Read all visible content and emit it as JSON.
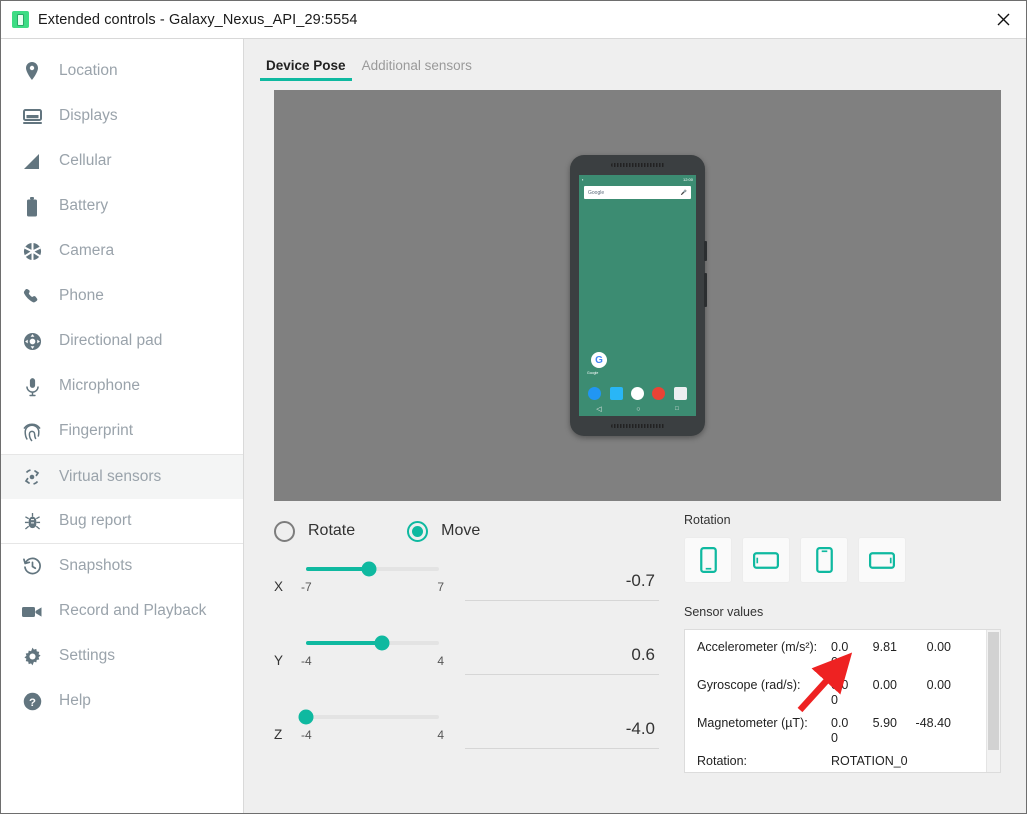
{
  "window": {
    "title": "Extended controls - Galaxy_Nexus_API_29:5554",
    "app_icon": "android-emulator-icon",
    "close_label": "×"
  },
  "sidebar": {
    "items": [
      {
        "label": "Location",
        "icon": "location-pin-icon",
        "active": false
      },
      {
        "label": "Displays",
        "icon": "monitor-icon",
        "active": false
      },
      {
        "label": "Cellular",
        "icon": "signal-bars-icon",
        "active": false
      },
      {
        "label": "Battery",
        "icon": "battery-icon",
        "active": false
      },
      {
        "label": "Camera",
        "icon": "camera-aperture-icon",
        "active": false
      },
      {
        "label": "Phone",
        "icon": "phone-handset-icon",
        "active": false
      },
      {
        "label": "Directional pad",
        "icon": "dpad-icon",
        "active": false
      },
      {
        "label": "Microphone",
        "icon": "microphone-icon",
        "active": false
      },
      {
        "label": "Fingerprint",
        "icon": "fingerprint-icon",
        "active": false
      },
      {
        "label": "Virtual sensors",
        "icon": "virtual-sensors-icon",
        "active": true
      },
      {
        "label": "Bug report",
        "icon": "bug-icon",
        "active": false
      },
      {
        "label": "Snapshots",
        "icon": "history-clock-icon",
        "active": false
      },
      {
        "label": "Record and Playback",
        "icon": "video-camera-icon",
        "active": false
      },
      {
        "label": "Settings",
        "icon": "gear-icon",
        "active": false
      },
      {
        "label": "Help",
        "icon": "question-mark-icon",
        "active": false
      }
    ]
  },
  "main": {
    "tabs": [
      {
        "label": "Device Pose",
        "active": true
      },
      {
        "label": "Additional sensors",
        "active": false
      }
    ],
    "preview": {
      "status_time": "12:00",
      "search_text": "Google",
      "app_label": "Google"
    },
    "mode": {
      "rotate_label": "Rotate",
      "move_label": "Move",
      "selected": "Move"
    },
    "sliders": [
      {
        "axis": "X",
        "min_label": "-7",
        "max_label": "7",
        "value": "-0.7",
        "percent": 47
      },
      {
        "axis": "Y",
        "min_label": "-4",
        "max_label": "4",
        "value": "0.6",
        "percent": 57
      },
      {
        "axis": "Z",
        "min_label": "-4",
        "max_label": "4",
        "value": "-4.0",
        "percent": 0
      }
    ],
    "rotation": {
      "label": "Rotation",
      "buttons": [
        {
          "name": "portrait",
          "icon": "phone-portrait-icon"
        },
        {
          "name": "landscape-left",
          "icon": "phone-landscape-icon"
        },
        {
          "name": "portrait-upside-down",
          "icon": "phone-portrait-flipped-icon"
        },
        {
          "name": "landscape-right",
          "icon": "phone-landscape-flipped-icon"
        }
      ]
    },
    "sensor_values": {
      "label": "Sensor values",
      "rows": [
        {
          "name": "Accelerometer (m/s²):",
          "x": "0.00",
          "y": "9.81",
          "z": "0.00"
        },
        {
          "name": "Gyroscope (rad/s):",
          "x": "0.00",
          "y": "0.00",
          "z": "0.00"
        },
        {
          "name": "Magnetometer (µT):",
          "x": "0.00",
          "y": "5.90",
          "z": "-48.40"
        },
        {
          "name": "Rotation:",
          "x": "",
          "y": "ROTATION_0",
          "z": ""
        }
      ]
    }
  },
  "colors": {
    "accent": "#0fb9a0",
    "sidebar_text": "#9aa3ab",
    "icon": "#62757f",
    "annotation": "#ee2222"
  }
}
